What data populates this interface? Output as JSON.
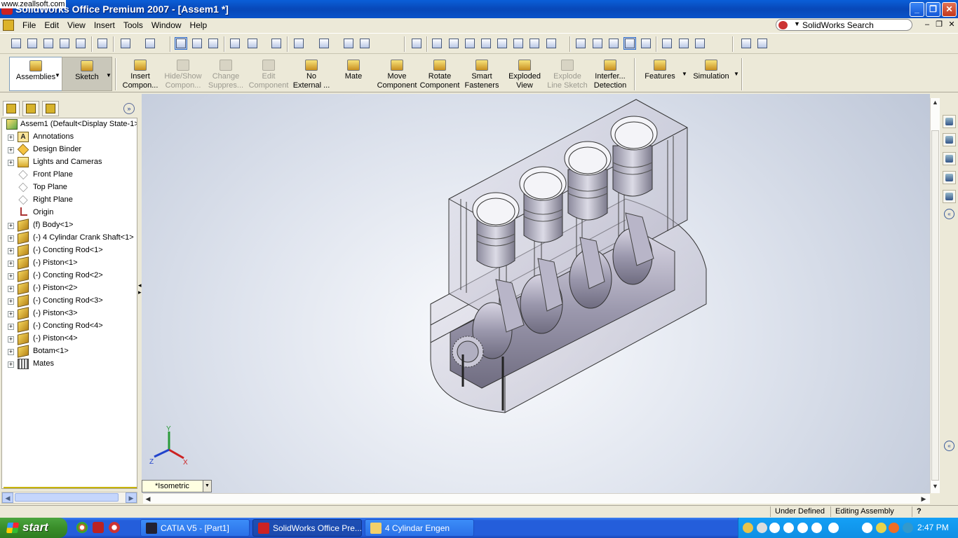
{
  "watermark": "www.zeallsoft.com",
  "window": {
    "title": "SolidWorks Office Premium 2007 - [Assem1 *]"
  },
  "menu": {
    "items": [
      "File",
      "Edit",
      "View",
      "Insert",
      "Tools",
      "Window",
      "Help"
    ]
  },
  "search": {
    "label": "SolidWorks Search"
  },
  "command_manager": {
    "tabs": [
      {
        "label": "Assemblies"
      },
      {
        "label": "Sketch"
      }
    ],
    "commands": [
      {
        "line1": "Insert",
        "line2": "Compon...",
        "enabled": true
      },
      {
        "line1": "Hide/Show",
        "line2": "Compon...",
        "enabled": false
      },
      {
        "line1": "Change",
        "line2": "Suppres...",
        "enabled": false
      },
      {
        "line1": "Edit",
        "line2": "Component",
        "enabled": false
      },
      {
        "line1": "No",
        "line2": "External ...",
        "enabled": true
      },
      {
        "line1": "Mate",
        "line2": "",
        "enabled": true
      },
      {
        "line1": "Move",
        "line2": "Component",
        "enabled": true
      },
      {
        "line1": "Rotate",
        "line2": "Component",
        "enabled": true
      },
      {
        "line1": "Smart",
        "line2": "Fasteners",
        "enabled": true
      },
      {
        "line1": "Exploded",
        "line2": "View",
        "enabled": true
      },
      {
        "line1": "Explode",
        "line2": "Line Sketch",
        "enabled": false
      },
      {
        "line1": "Interfer...",
        "line2": "Detection",
        "enabled": true
      },
      {
        "line1": "Features",
        "line2": "",
        "enabled": true
      },
      {
        "line1": "Simulation",
        "line2": "",
        "enabled": true
      }
    ]
  },
  "feature_tree": {
    "root": "Assem1  (Default<Display State-1>",
    "items": [
      {
        "label": "Annotations",
        "icon": "annotations-icon",
        "expandable": true
      },
      {
        "label": "Design Binder",
        "icon": "design-binder-icon",
        "expandable": true
      },
      {
        "label": "Lights and Cameras",
        "icon": "lights-cameras-icon",
        "expandable": true
      },
      {
        "label": "Front Plane",
        "icon": "plane-icon",
        "expandable": false
      },
      {
        "label": "Top Plane",
        "icon": "plane-icon",
        "expandable": false
      },
      {
        "label": "Right Plane",
        "icon": "plane-icon",
        "expandable": false
      },
      {
        "label": "Origin",
        "icon": "origin-icon",
        "expandable": false
      },
      {
        "label": "(f) Body<1>",
        "icon": "part-icon",
        "expandable": true
      },
      {
        "label": "(-) 4 Cylindar Crank Shaft<1>",
        "icon": "part-icon",
        "expandable": true
      },
      {
        "label": "(-) Concting Rod<1>",
        "icon": "part-icon",
        "expandable": true
      },
      {
        "label": "(-) Piston<1>",
        "icon": "part-icon",
        "expandable": true
      },
      {
        "label": "(-) Concting Rod<2>",
        "icon": "part-icon",
        "expandable": true
      },
      {
        "label": "(-) Piston<2>",
        "icon": "part-icon",
        "expandable": true
      },
      {
        "label": "(-) Concting Rod<3>",
        "icon": "part-icon",
        "expandable": true
      },
      {
        "label": "(-) Piston<3>",
        "icon": "part-icon",
        "expandable": true
      },
      {
        "label": "(-) Concting Rod<4>",
        "icon": "part-icon",
        "expandable": true
      },
      {
        "label": "(-) Piston<4>",
        "icon": "part-icon",
        "expandable": true
      },
      {
        "label": "Botam<1>",
        "icon": "part-icon",
        "expandable": true
      },
      {
        "label": "Mates",
        "icon": "mates-icon",
        "expandable": true
      }
    ]
  },
  "viewport": {
    "view_name": "*Isometric",
    "triad": {
      "x": "X",
      "y": "Y",
      "z": "Z"
    }
  },
  "status": {
    "state": "Under Defined",
    "mode": "Editing Assembly",
    "help": "?"
  },
  "taskbar": {
    "start": "start",
    "tasks": [
      {
        "label": "CATIA V5 - [Part1]",
        "active": false
      },
      {
        "label": "SolidWorks Office Pre...",
        "active": true
      },
      {
        "label": "4 Cylindar Engen",
        "active": false
      }
    ],
    "clock": "2:47 PM"
  },
  "colors": {
    "titlebar": "#0a5fd8",
    "taskbar": "#245edb",
    "start": "#3a8e2a",
    "viewport_bg": "#c3cad8",
    "model_edge": "#3a3a44"
  }
}
